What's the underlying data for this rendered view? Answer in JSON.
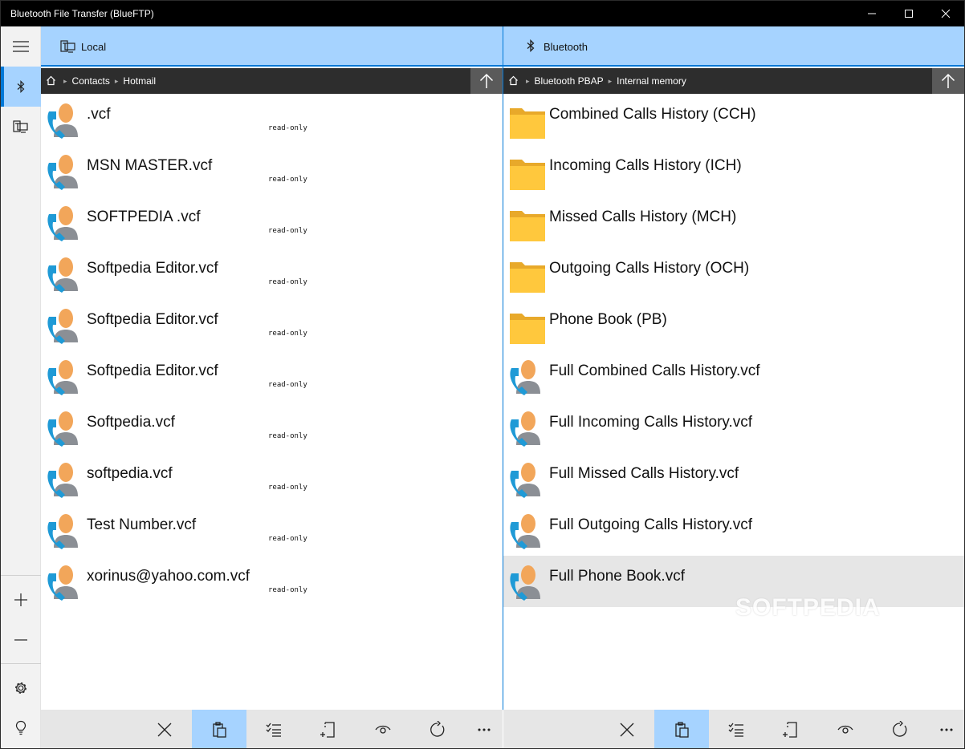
{
  "window": {
    "title": "Bluetooth File Transfer (BlueFTP)"
  },
  "sidebar": {
    "active": "bluetooth-icon",
    "icons": [
      "menu-icon",
      "bluetooth-icon",
      "local-computer-icon",
      "add-icon",
      "remove-icon",
      "settings-icon",
      "lightbulb-icon"
    ]
  },
  "left_pane": {
    "header_label": "Local",
    "breadcrumb": [
      "Contacts",
      "Hotmail"
    ],
    "items": [
      {
        "name": ".vcf",
        "note": "read-only"
      },
      {
        "name": "MSN MASTER.vcf",
        "note": "read-only"
      },
      {
        "name": "SOFTPEDIA .vcf",
        "note": "read-only"
      },
      {
        "name": "Softpedia Editor.vcf",
        "note": "read-only"
      },
      {
        "name": "Softpedia Editor.vcf",
        "note": "read-only"
      },
      {
        "name": "Softpedia Editor.vcf",
        "note": "read-only"
      },
      {
        "name": "Softpedia.vcf",
        "note": "read-only"
      },
      {
        "name": "softpedia.vcf",
        "note": "read-only"
      },
      {
        "name": "Test Number.vcf",
        "note": "read-only"
      },
      {
        "name": "xorinus@yahoo.com.vcf",
        "note": "read-only"
      }
    ],
    "toolbar": [
      "close-icon",
      "paste-icon",
      "select-all-icon",
      "new-file-icon",
      "view-icon",
      "refresh-icon",
      "more-icon"
    ],
    "toolbar_active": "paste-icon"
  },
  "right_pane": {
    "header_label": "Bluetooth",
    "breadcrumb": [
      "Bluetooth PBAP",
      "Internal memory"
    ],
    "items": [
      {
        "name": "Combined Calls History (CCH)",
        "kind": "folder"
      },
      {
        "name": "Incoming Calls History (ICH)",
        "kind": "folder"
      },
      {
        "name": "Missed Calls History (MCH)",
        "kind": "folder"
      },
      {
        "name": "Outgoing Calls History (OCH)",
        "kind": "folder"
      },
      {
        "name": "Phone Book (PB)",
        "kind": "folder"
      },
      {
        "name": "Full Combined Calls History.vcf",
        "kind": "contact"
      },
      {
        "name": "Full Incoming Calls History.vcf",
        "kind": "contact"
      },
      {
        "name": "Full Missed Calls History.vcf",
        "kind": "contact"
      },
      {
        "name": "Full Outgoing Calls History.vcf",
        "kind": "contact"
      },
      {
        "name": "Full Phone Book.vcf",
        "kind": "contact",
        "selected": true
      }
    ],
    "toolbar": [
      "close-icon",
      "paste-icon",
      "select-all-icon",
      "new-file-icon",
      "view-icon",
      "refresh-icon",
      "more-icon"
    ],
    "toolbar_active": "paste-icon"
  },
  "watermark": "SOFTPEDIA",
  "colors": {
    "accent": "#0078d7",
    "header_bg": "#a6d3ff",
    "crumb_bg": "#2d2d2d",
    "folder": "#ffc83d",
    "contact_phone": "#1f9ad6",
    "contact_head": "#f2a65a"
  }
}
